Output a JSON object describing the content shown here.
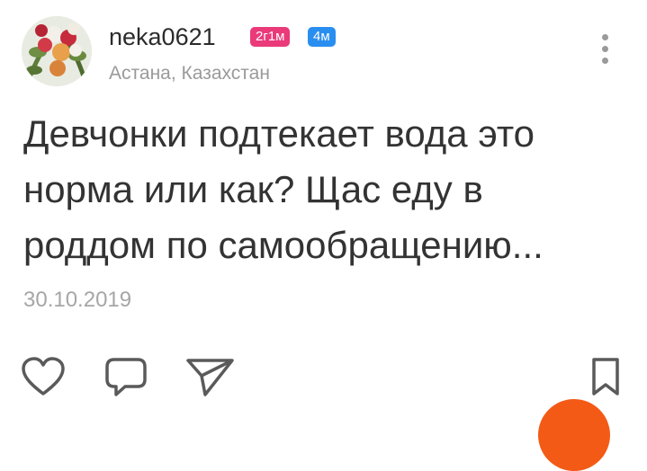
{
  "author": {
    "username": "neka0621",
    "badges": [
      {
        "label": "2г1м",
        "color": "#ea3a7a"
      },
      {
        "label": "4м",
        "color": "#2a8ef0"
      }
    ],
    "location": "Астана, Казахстан"
  },
  "post": {
    "lines": [
      "Девчонки подтекает вода это",
      "норма или как? Щас еду в",
      "роддом по самообращению..."
    ],
    "date": "30.10.2019"
  },
  "icons": {
    "menu": "more-vertical-icon",
    "like": "heart-icon",
    "comment": "comment-icon",
    "share": "send-icon",
    "save": "bookmark-icon"
  },
  "colors": {
    "accent_orange": "#f35a16",
    "text_secondary": "#9a9a9a"
  }
}
